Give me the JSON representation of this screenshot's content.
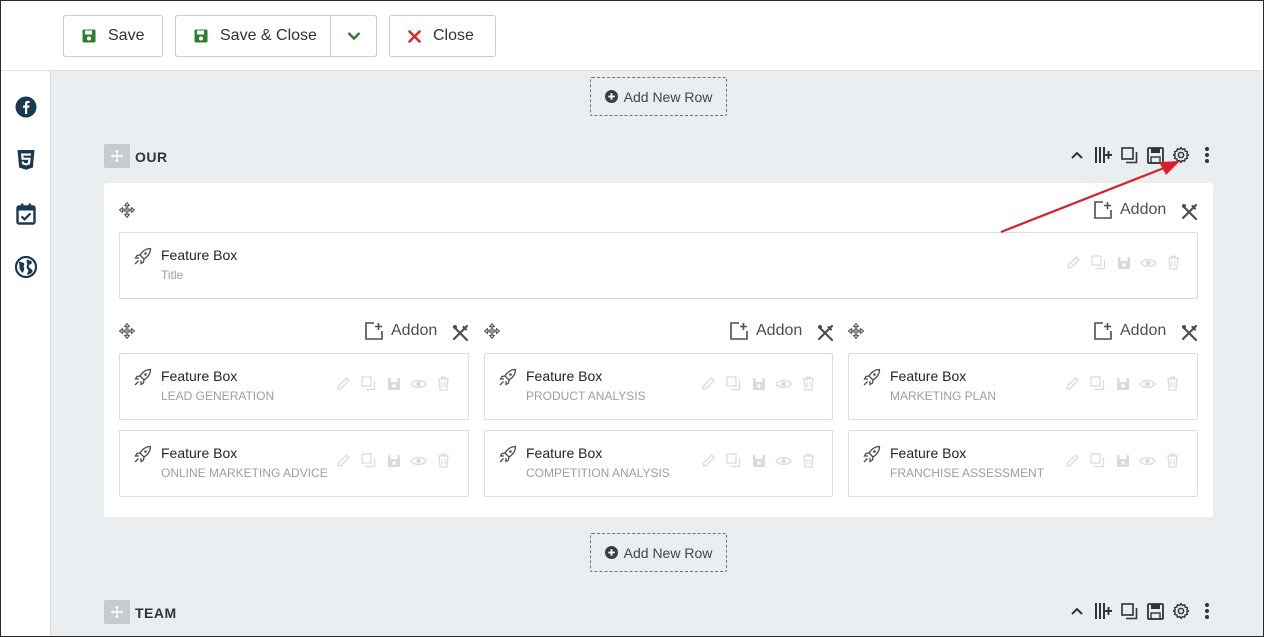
{
  "toolbar": {
    "save_label": "Save",
    "save_close_label": "Save & Close",
    "close_label": "Close"
  },
  "sidebar": {
    "icons": [
      "facebook-icon",
      "css3-icon",
      "calendar-check-icon",
      "globe-icon"
    ]
  },
  "add_row_label": "Add New Row",
  "sections": [
    {
      "title": "OUR",
      "top_box": {
        "title": "Feature Box",
        "subtitle": "Title"
      },
      "addon_label": "Addon",
      "columns": [
        {
          "boxes": [
            {
              "title": "Feature Box",
              "subtitle": "LEAD GENERATION"
            },
            {
              "title": "Feature Box",
              "subtitle": "ONLINE MARKETING ADVICE"
            }
          ]
        },
        {
          "boxes": [
            {
              "title": "Feature Box",
              "subtitle": "PRODUCT ANALYSIS"
            },
            {
              "title": "Feature Box",
              "subtitle": "COMPETITION ANALYSIS"
            }
          ]
        },
        {
          "boxes": [
            {
              "title": "Feature Box",
              "subtitle": "MARKETING PLAN"
            },
            {
              "title": "Feature Box",
              "subtitle": "FRANCHISE ASSESSMENT"
            }
          ]
        }
      ]
    },
    {
      "title": "TEAM"
    }
  ],
  "colors": {
    "save_icon": "#2e7d32",
    "close_icon": "#d32f2f",
    "sidebar_icon": "#1a3a52",
    "arrow": "#d8202a",
    "canvas_bg": "#eaeef1"
  }
}
